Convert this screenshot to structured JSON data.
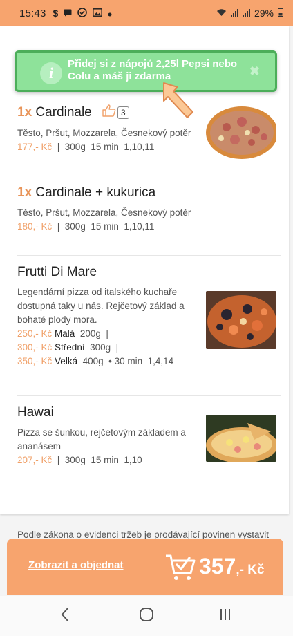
{
  "status_bar": {
    "time": "15:43",
    "battery": "29%"
  },
  "toast": {
    "icon": "info-icon",
    "message": "Přidej si z nápojů 2,25l Pepsi nebo Colu a máš ji zdarma"
  },
  "items": [
    {
      "qty": "1x",
      "name": "Cardinale",
      "likes": "3",
      "description": "Těsto, Pršut, Mozzarela, Česnekový potěr",
      "price": "177,- Kč",
      "details": "  |  300g  15 min  1,10,11"
    },
    {
      "qty": "1x",
      "name": "Cardinale + kukurica",
      "description": "Těsto, Pršut, Mozzarela, Česnekový potěr",
      "price": "180,- Kč",
      "details": "  |  300g  15 min  1,10,11"
    },
    {
      "name": "Frutti Di Mare",
      "description": "Legendární pizza od italského kuchaře dostupná taky u nás. Rejčetový základ a bohaté plody mora.",
      "sizes": [
        {
          "price": "250,- Kč",
          "size": "Malá",
          "details": "  200g  |"
        },
        {
          "price": "300,- Kč",
          "size": "Střední",
          "details": "  300g  |"
        },
        {
          "price": "350,- Kč",
          "size": "Velká",
          "details": "  400g  • 30 min  1,4,14"
        }
      ]
    },
    {
      "name": "Hawai",
      "description": "Pizza se šunkou, rejčetovým základem a ananásem",
      "price": "207,- Kč",
      "details": "  |  300g  15 min  1,10"
    }
  ],
  "legal_text": "Podle zákona o evidenci tržeb je prodávající povinen vystavit",
  "order_bar": {
    "link_label": "Zobrazit a objednat",
    "total": "357",
    "currency": ",- Kč"
  },
  "colors": {
    "accent": "#f7a46e",
    "price": "#f0a068",
    "toast_bg": "#8ee29a",
    "toast_border": "#4cae5a"
  }
}
